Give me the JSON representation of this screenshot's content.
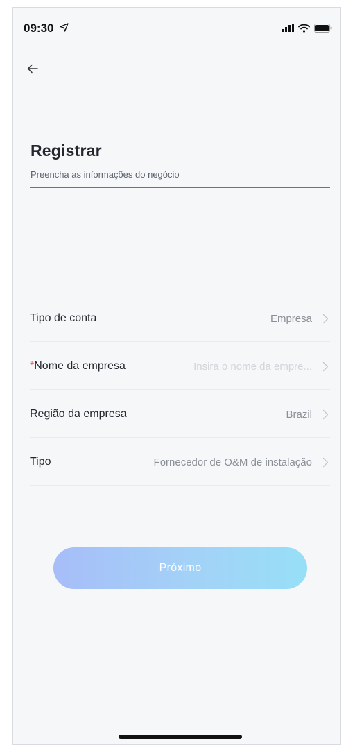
{
  "status_bar": {
    "time": "09:30"
  },
  "header": {
    "title": "Registrar",
    "subtitle": "Preencha as informações do negócio"
  },
  "form": {
    "rows": [
      {
        "label": "Tipo de conta",
        "value": "Empresa",
        "required": false
      },
      {
        "label": "Nome da empresa",
        "placeholder": "Insira o nome da empre...",
        "required": true
      },
      {
        "label": "Região da empresa",
        "value": "Brazil",
        "required": false
      },
      {
        "label": "Tipo",
        "value": "Fornecedor de O&M de instalação",
        "required": false
      }
    ],
    "required_marker": "*"
  },
  "actions": {
    "next_label": "Próximo"
  },
  "colors": {
    "accent_line": "#4a78c2",
    "required": "#f25c54",
    "button_gradient_start": "#a7bdf8",
    "button_gradient_end": "#97dff7"
  }
}
